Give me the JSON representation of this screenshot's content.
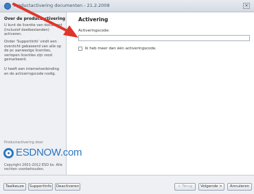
{
  "window": {
    "title": "Productactivering documenten - 21.2.2008",
    "close_label": "×"
  },
  "sidebar": {
    "heading": "Over de productactivering",
    "paragraphs": [
      "U kunt de licentie van document (inclusief deelbestanden) activeren.",
      "Onder 'Supportinfo' vindt een overzicht gebaseerd van alle op de pc aanwezige licenties, verlopen licenties zijn rood gemarkeerd.",
      "U heeft een internetverbinding en de activeringscode nodig."
    ],
    "powered_by": "Productactivering door",
    "logo_text": "ESDNOW.com",
    "copyright": "Copyright 2001-2012 ESD bv. Alle rechten voorbehouden."
  },
  "main": {
    "heading": "Activering",
    "code_label": "Activeringscode:",
    "code_value": "",
    "checkbox_label": "Ik heb meer dan één activeringscode."
  },
  "footer": {
    "left_buttons": [
      "Taalkeuze",
      "Supportinfo",
      "Deactiveren"
    ],
    "back_label": "< Terug",
    "next_label": "Volgende >",
    "cancel_label": "Annuleren"
  },
  "colors": {
    "accent": "#2c76c0",
    "arrow": "#e0352b"
  },
  "icons": [
    "app-icon",
    "close-icon",
    "esdnow-logo-icon",
    "red-arrow-annotation"
  ]
}
